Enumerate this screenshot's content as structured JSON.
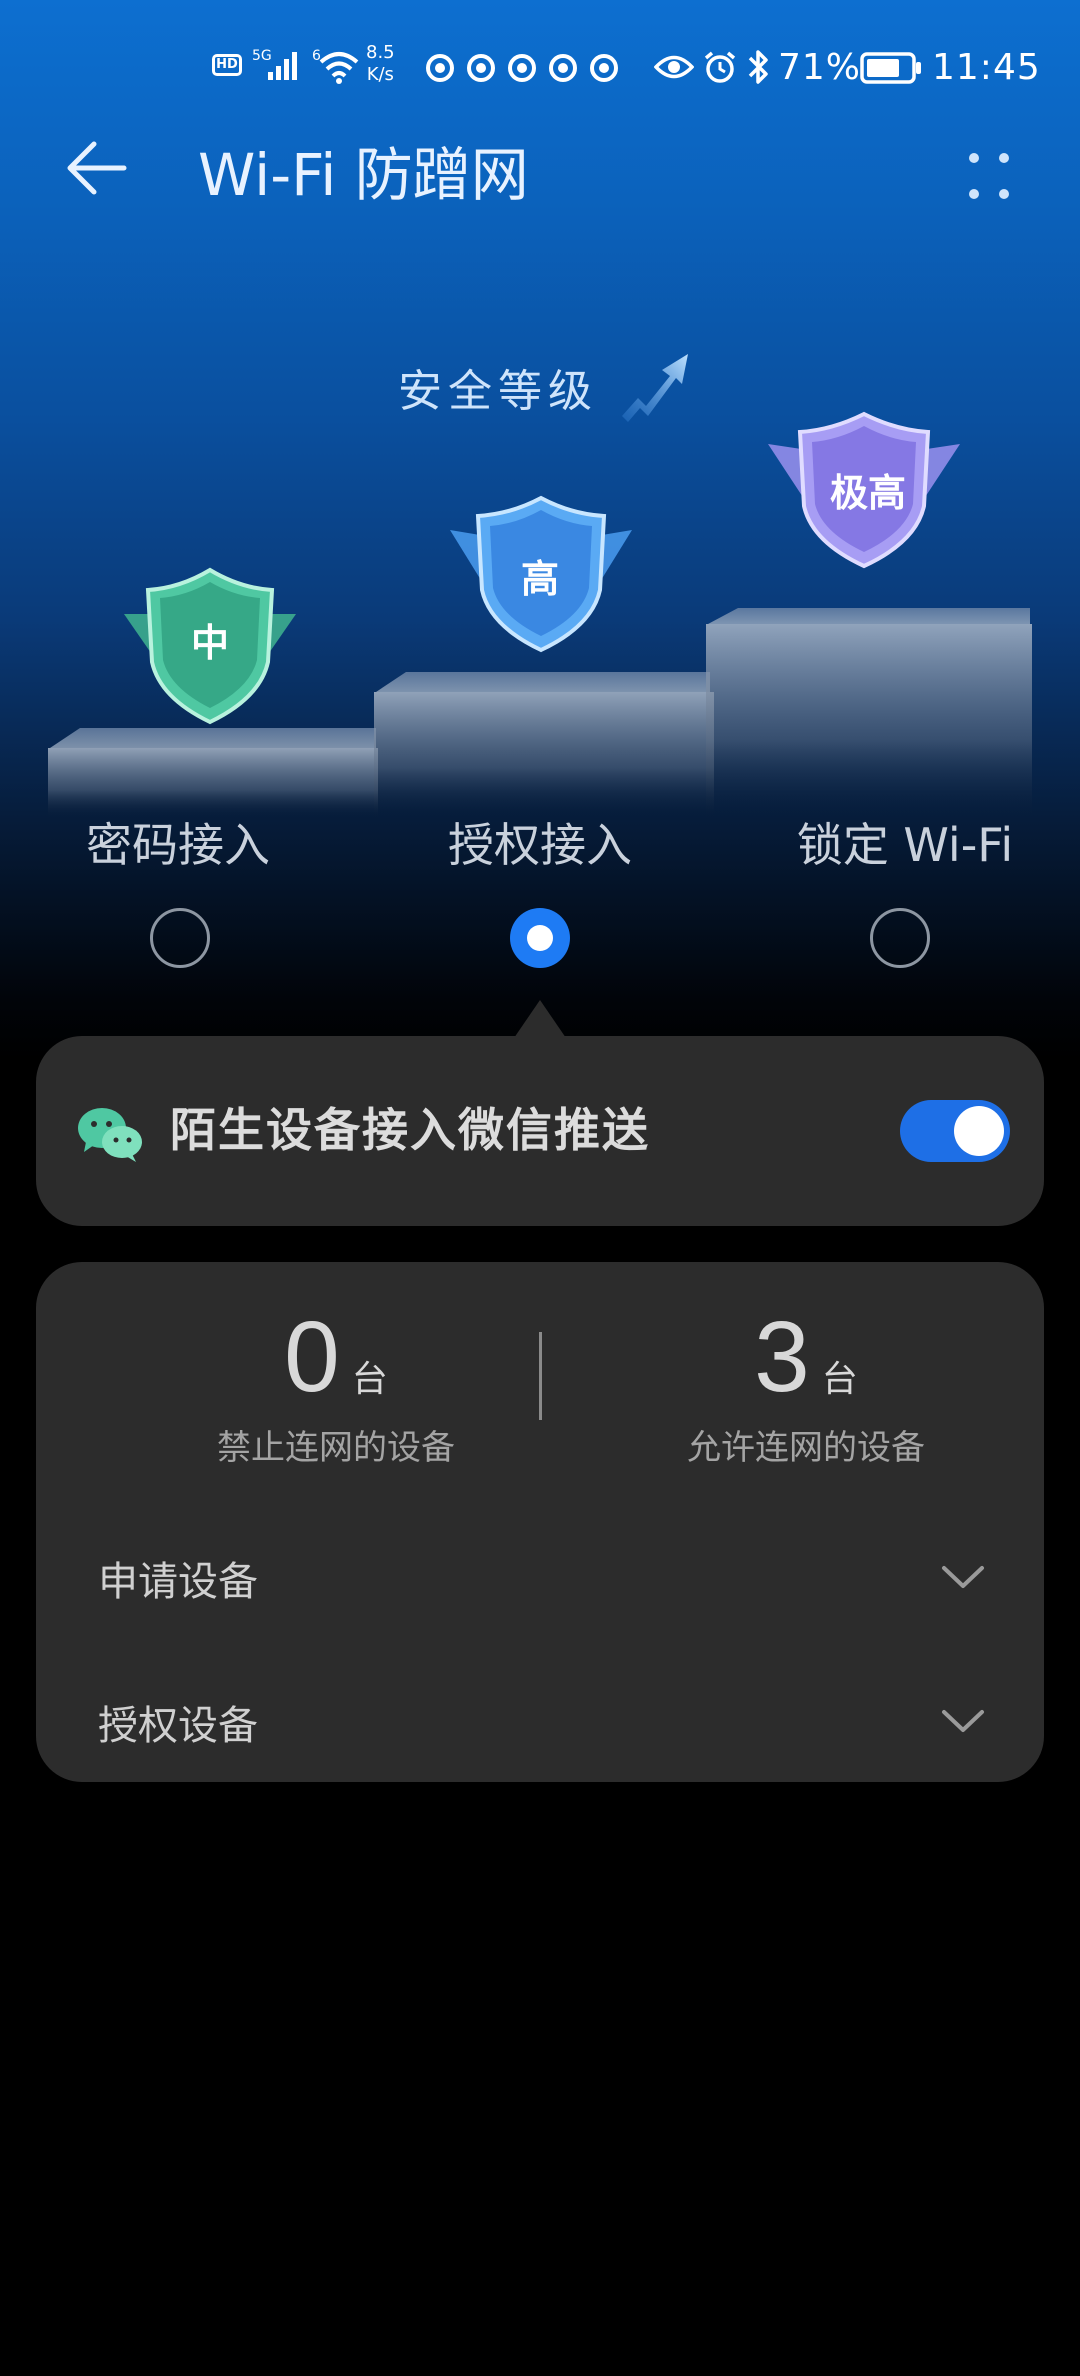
{
  "status_bar": {
    "hd": "HD",
    "signal_label": "5G",
    "wifi_label": "6",
    "speed": "8.5",
    "speed_unit": "K/s",
    "battery": "71%",
    "time": "11:45"
  },
  "app_bar": {
    "title": "Wi-Fi 防蹭网"
  },
  "security": {
    "heading": "安全等级",
    "levels": [
      {
        "label": "中",
        "color": "#3fb48f"
      },
      {
        "label": "高",
        "color": "#3c8ee8"
      },
      {
        "label": "极高",
        "color": "#8a7ee6"
      }
    ],
    "options": [
      {
        "label": "密码接入",
        "selected": false
      },
      {
        "label": "授权接入",
        "selected": true
      },
      {
        "label": "锁定 Wi-Fi",
        "selected": false
      }
    ]
  },
  "wechat_push": {
    "label": "陌生设备接入微信推送",
    "enabled": true,
    "accent": "#1e6fe6"
  },
  "devices": {
    "blocked": {
      "count": "0",
      "unit": "台",
      "label": "禁止连网的设备"
    },
    "allowed": {
      "count": "3",
      "unit": "台",
      "label": "允许连网的设备"
    },
    "sections": [
      {
        "label": "申请设备"
      },
      {
        "label": "授权设备"
      }
    ]
  }
}
